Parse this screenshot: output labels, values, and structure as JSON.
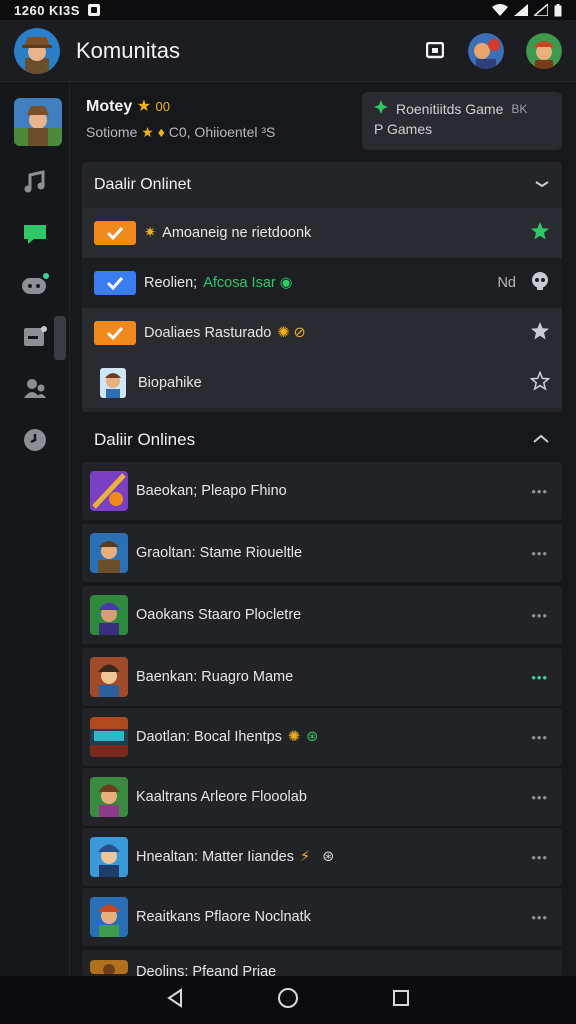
{
  "status_bar": {
    "time": "1260 KI3S"
  },
  "header": {
    "title": "Komunitas"
  },
  "profile": {
    "name": "Motey",
    "name_suffix": "00",
    "sub_prefix": "Sotiome",
    "sub_mid": "C0, Ohiioentel",
    "sub_end": "³S"
  },
  "games_chip": {
    "line1": "Roenitiitds Game",
    "line1_tag": "BK",
    "line2": "P Games"
  },
  "panel1": {
    "title": "Daalir Onlinet",
    "rows": [
      {
        "text": "Amoaneig ne rietdoonk"
      },
      {
        "text_a": "Reolien;",
        "text_b": "Afcosa Isar",
        "end_label": "Nd"
      },
      {
        "text": "Doaliaes Rasturado"
      },
      {
        "text": "Biopahike"
      }
    ]
  },
  "section2": {
    "title": "Daliir Onlines"
  },
  "games": [
    {
      "label": "Baeokan; Pleapo Fhino",
      "dots": "•••"
    },
    {
      "label": "Graoltan: Stame Rioueltle",
      "dots": "•••"
    },
    {
      "label": "Oaokans Staaro Plocletre",
      "dots": "•••"
    },
    {
      "label": "Baenkan: Ruagro Mame",
      "dots": "•••"
    },
    {
      "label": "Daotlan: Bocal Ihentps",
      "dots": "•••"
    },
    {
      "label": "Kaaltrans Arleore Flooolab",
      "dots": "•••"
    },
    {
      "label": "Hnealtan: Matter Iiandes",
      "dots": "•••"
    },
    {
      "label": "Reaitkans Pflaore Noclnatk",
      "dots": "•••"
    },
    {
      "label": "Deolins: Pfeand Priae",
      "dots": ""
    }
  ],
  "colors": {
    "accent_green": "#2fc768",
    "checkbox_orange": "#f08a1c",
    "checkbox_blue": "#3b7cf0",
    "gold": "#f2b21b"
  }
}
